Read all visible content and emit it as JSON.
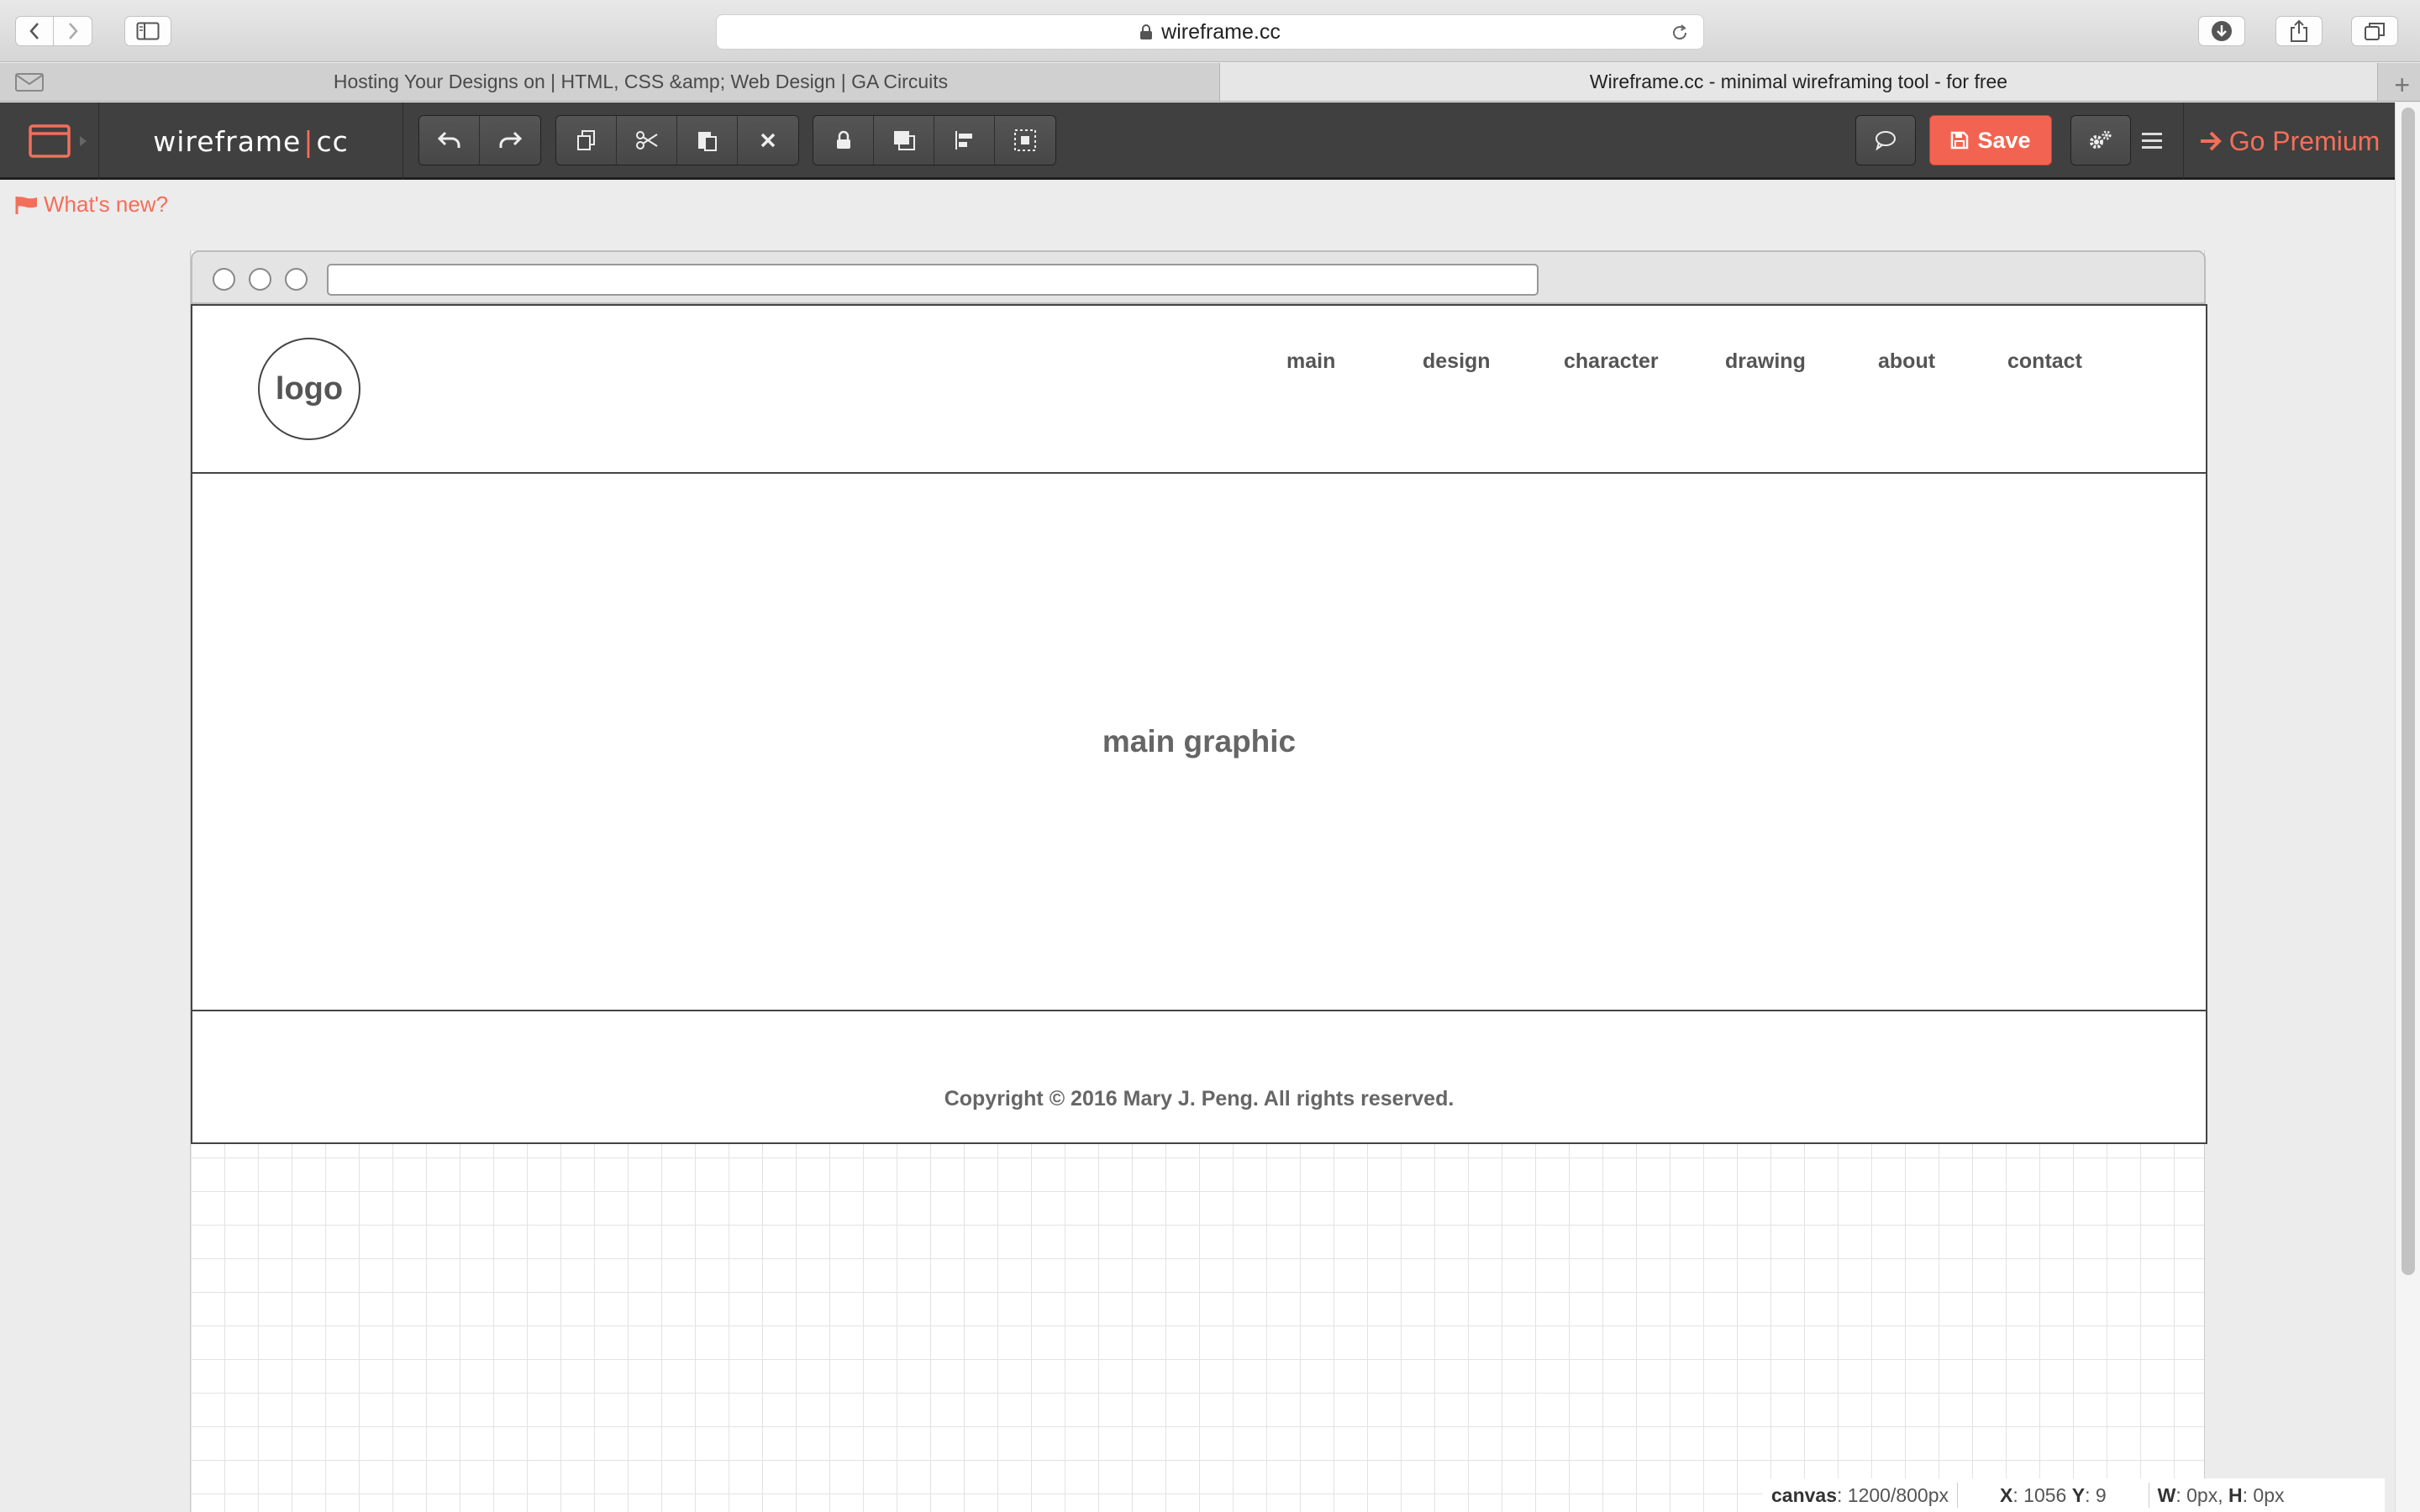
{
  "browser": {
    "url": "wireframe.cc",
    "tabs": [
      {
        "title": "Hosting Your Designs on | HTML, CSS &amp; Web Design | GA Circuits",
        "active": false
      },
      {
        "title": "Wireframe.cc - minimal wireframing tool - for free",
        "active": true
      }
    ]
  },
  "app": {
    "brand_left": "wireframe",
    "brand_sep": "|",
    "brand_right": "cc",
    "save_label": "Save",
    "premium_label": "Go Premium",
    "whats_new_label": "What's new?",
    "accent_color": "#f36f5a"
  },
  "wireframe": {
    "logo_label": "logo",
    "nav": [
      "main",
      "design",
      "character",
      "drawing",
      "about",
      "contact"
    ],
    "hero_label": "main graphic",
    "footer_text": "Copyright © 2016 Mary J. Peng. All rights reserved."
  },
  "status": {
    "canvas_label": "canvas",
    "canvas_value": "1200/800px",
    "x_label": "X",
    "x_value": "1056",
    "y_label": "Y",
    "y_value": "9",
    "w_label": "W",
    "w_value": "0px",
    "h_label": "H",
    "h_value": "0px"
  }
}
